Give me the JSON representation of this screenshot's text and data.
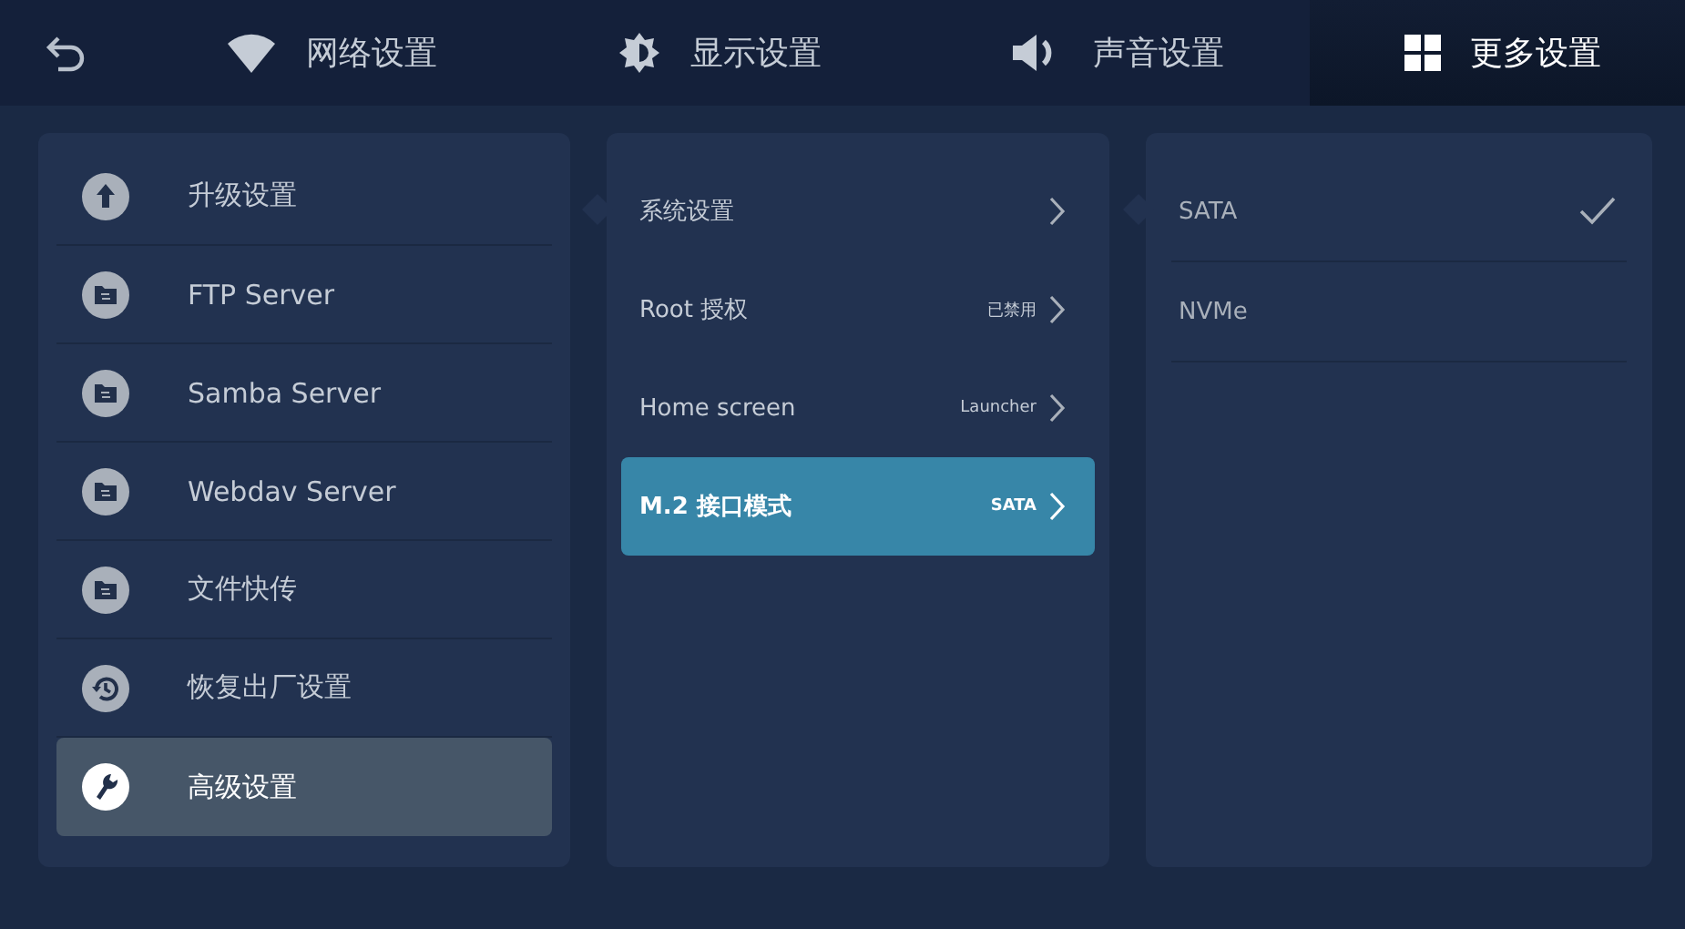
{
  "tabs": [
    {
      "label": "网络设置",
      "kind": "wifi",
      "selected": false
    },
    {
      "label": "显示设置",
      "kind": "brightness",
      "selected": false
    },
    {
      "label": "声音设置",
      "kind": "sound",
      "selected": false
    },
    {
      "label": "更多设置",
      "kind": "grid",
      "selected": true
    }
  ],
  "menu": [
    {
      "label": "升级设置",
      "kind": "upload",
      "selected": false
    },
    {
      "label": "FTP Server",
      "kind": "folder",
      "selected": false
    },
    {
      "label": "Samba Server",
      "kind": "folder",
      "selected": false
    },
    {
      "label": "Webdav Server",
      "kind": "folder",
      "selected": false
    },
    {
      "label": "文件快传",
      "kind": "folder",
      "selected": false
    },
    {
      "label": "恢复出厂设置",
      "kind": "restore",
      "selected": false
    },
    {
      "label": "高级设置",
      "kind": "wrench",
      "selected": true
    }
  ],
  "settings": [
    {
      "label": "系统设置",
      "selected": false
    },
    {
      "label": "Root 授权",
      "value": "已禁用",
      "selected": false
    },
    {
      "label": "Home screen",
      "value": "Launcher",
      "selected": false
    },
    {
      "label": "M.2 接口模式",
      "value": "SATA",
      "selected": true
    }
  ],
  "options": [
    {
      "label": "SATA",
      "selected": true
    },
    {
      "label": "NVMe",
      "selected": false
    }
  ]
}
